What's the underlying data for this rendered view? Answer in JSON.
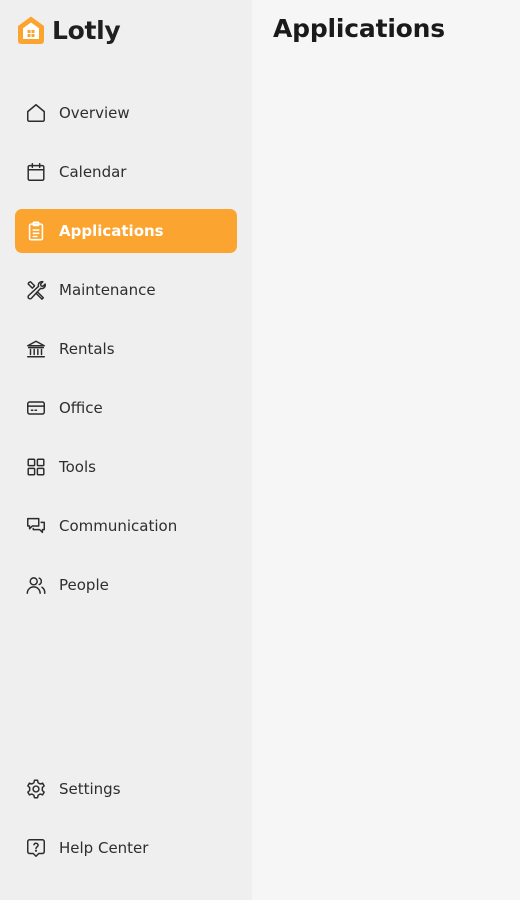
{
  "brand": {
    "name": "Lotly",
    "accent_color": "#fba42f"
  },
  "page": {
    "title": "Applications"
  },
  "sidebar": {
    "items": [
      {
        "label": "Overview",
        "icon": "home-icon",
        "active": false
      },
      {
        "label": "Calendar",
        "icon": "calendar-icon",
        "active": false
      },
      {
        "label": "Applications",
        "icon": "clipboard-icon",
        "active": true
      },
      {
        "label": "Maintenance",
        "icon": "tools-icon",
        "active": false
      },
      {
        "label": "Rentals",
        "icon": "bank-icon",
        "active": false
      },
      {
        "label": "Office",
        "icon": "credit-card-icon",
        "active": false
      },
      {
        "label": "Tools",
        "icon": "grid-icon",
        "active": false
      },
      {
        "label": "Communication",
        "icon": "chat-icon",
        "active": false
      },
      {
        "label": "People",
        "icon": "users-icon",
        "active": false
      }
    ],
    "footer_items": [
      {
        "label": "Settings",
        "icon": "gear-icon"
      },
      {
        "label": "Help Center",
        "icon": "help-icon"
      }
    ]
  }
}
